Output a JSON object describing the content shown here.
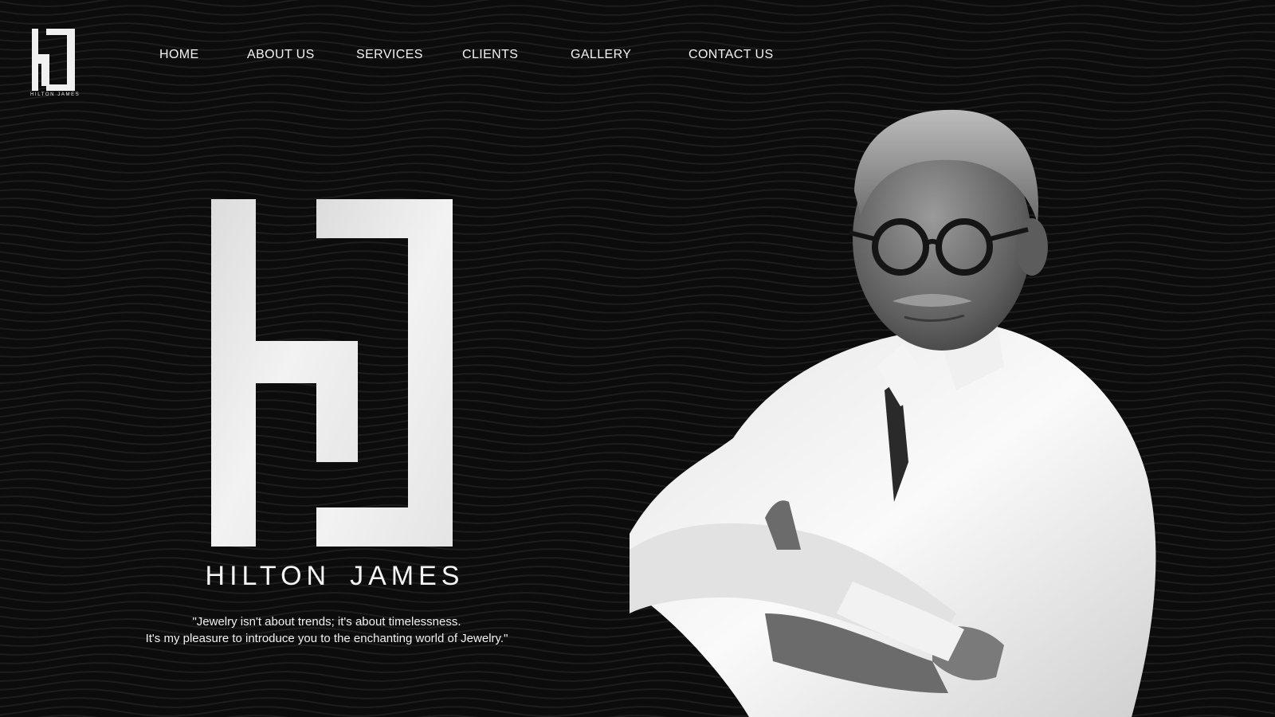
{
  "brand": {
    "logo_text": "HILTON JAMES",
    "hero_first": "HILTON",
    "hero_last": "JAMES"
  },
  "nav": {
    "items": [
      {
        "label": "HOME"
      },
      {
        "label": "ABOUT US"
      },
      {
        "label": "SERVICES"
      },
      {
        "label": "CLIENTS"
      },
      {
        "label": "GALLERY"
      },
      {
        "label": "CONTACT US"
      }
    ]
  },
  "quote": {
    "line1": "\"Jewelry isn't about trends; it's about timelessness.",
    "line2": "It's my pleasure to introduce you to the enchanting world of Jewelry.\""
  },
  "colors": {
    "background": "#0c0c0c",
    "text": "#f2f2f2",
    "logo": "#f0f0f0"
  }
}
